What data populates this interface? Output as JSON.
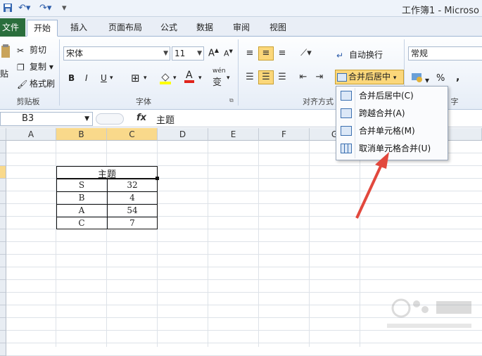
{
  "window": {
    "title": "工作簿1 - Microso"
  },
  "tabs": [
    "文件",
    "开始",
    "插入",
    "页面布局",
    "公式",
    "数据",
    "审阅",
    "视图"
  ],
  "active_tab_index": 1,
  "ribbon": {
    "clipboard": {
      "cut": "剪切",
      "copy": "复制",
      "format_painter": "格式刷",
      "paste_partial": "贴",
      "group_label": "剪贴板"
    },
    "font": {
      "name": "宋体",
      "size": "11",
      "bold": "B",
      "italic": "I",
      "underline": "U",
      "font_color_glyph": "A",
      "phonetic_glyph": "wén",
      "phonetic_sub": "变",
      "group_label": "字体"
    },
    "alignment": {
      "wrap_text": "自动换行",
      "merge_center": "合并后居中",
      "group_label": "对齐方式"
    },
    "number": {
      "format": "常规",
      "percent": "%",
      "comma": ",",
      "group_label_partial": "字"
    }
  },
  "formula_bar": {
    "name_box": "B3",
    "fx": "fx",
    "content": "主题"
  },
  "columns": [
    "A",
    "B",
    "C",
    "D",
    "E",
    "F",
    "G"
  ],
  "selected_columns": [
    "B",
    "C"
  ],
  "table": {
    "header": "主题",
    "rows": [
      {
        "label": "S",
        "value": "32"
      },
      {
        "label": "B",
        "value": "4"
      },
      {
        "label": "A",
        "value": "54"
      },
      {
        "label": "C",
        "value": "7"
      }
    ]
  },
  "merge_menu": {
    "items": [
      "合并后居中(C)",
      "跨越合并(A)",
      "合并单元格(M)",
      "取消单元格合并(U)"
    ]
  },
  "colors": {
    "accent_highlight": "#fbd77a",
    "file_tab": "#2a6e3c",
    "arrow": "#e2483d"
  }
}
